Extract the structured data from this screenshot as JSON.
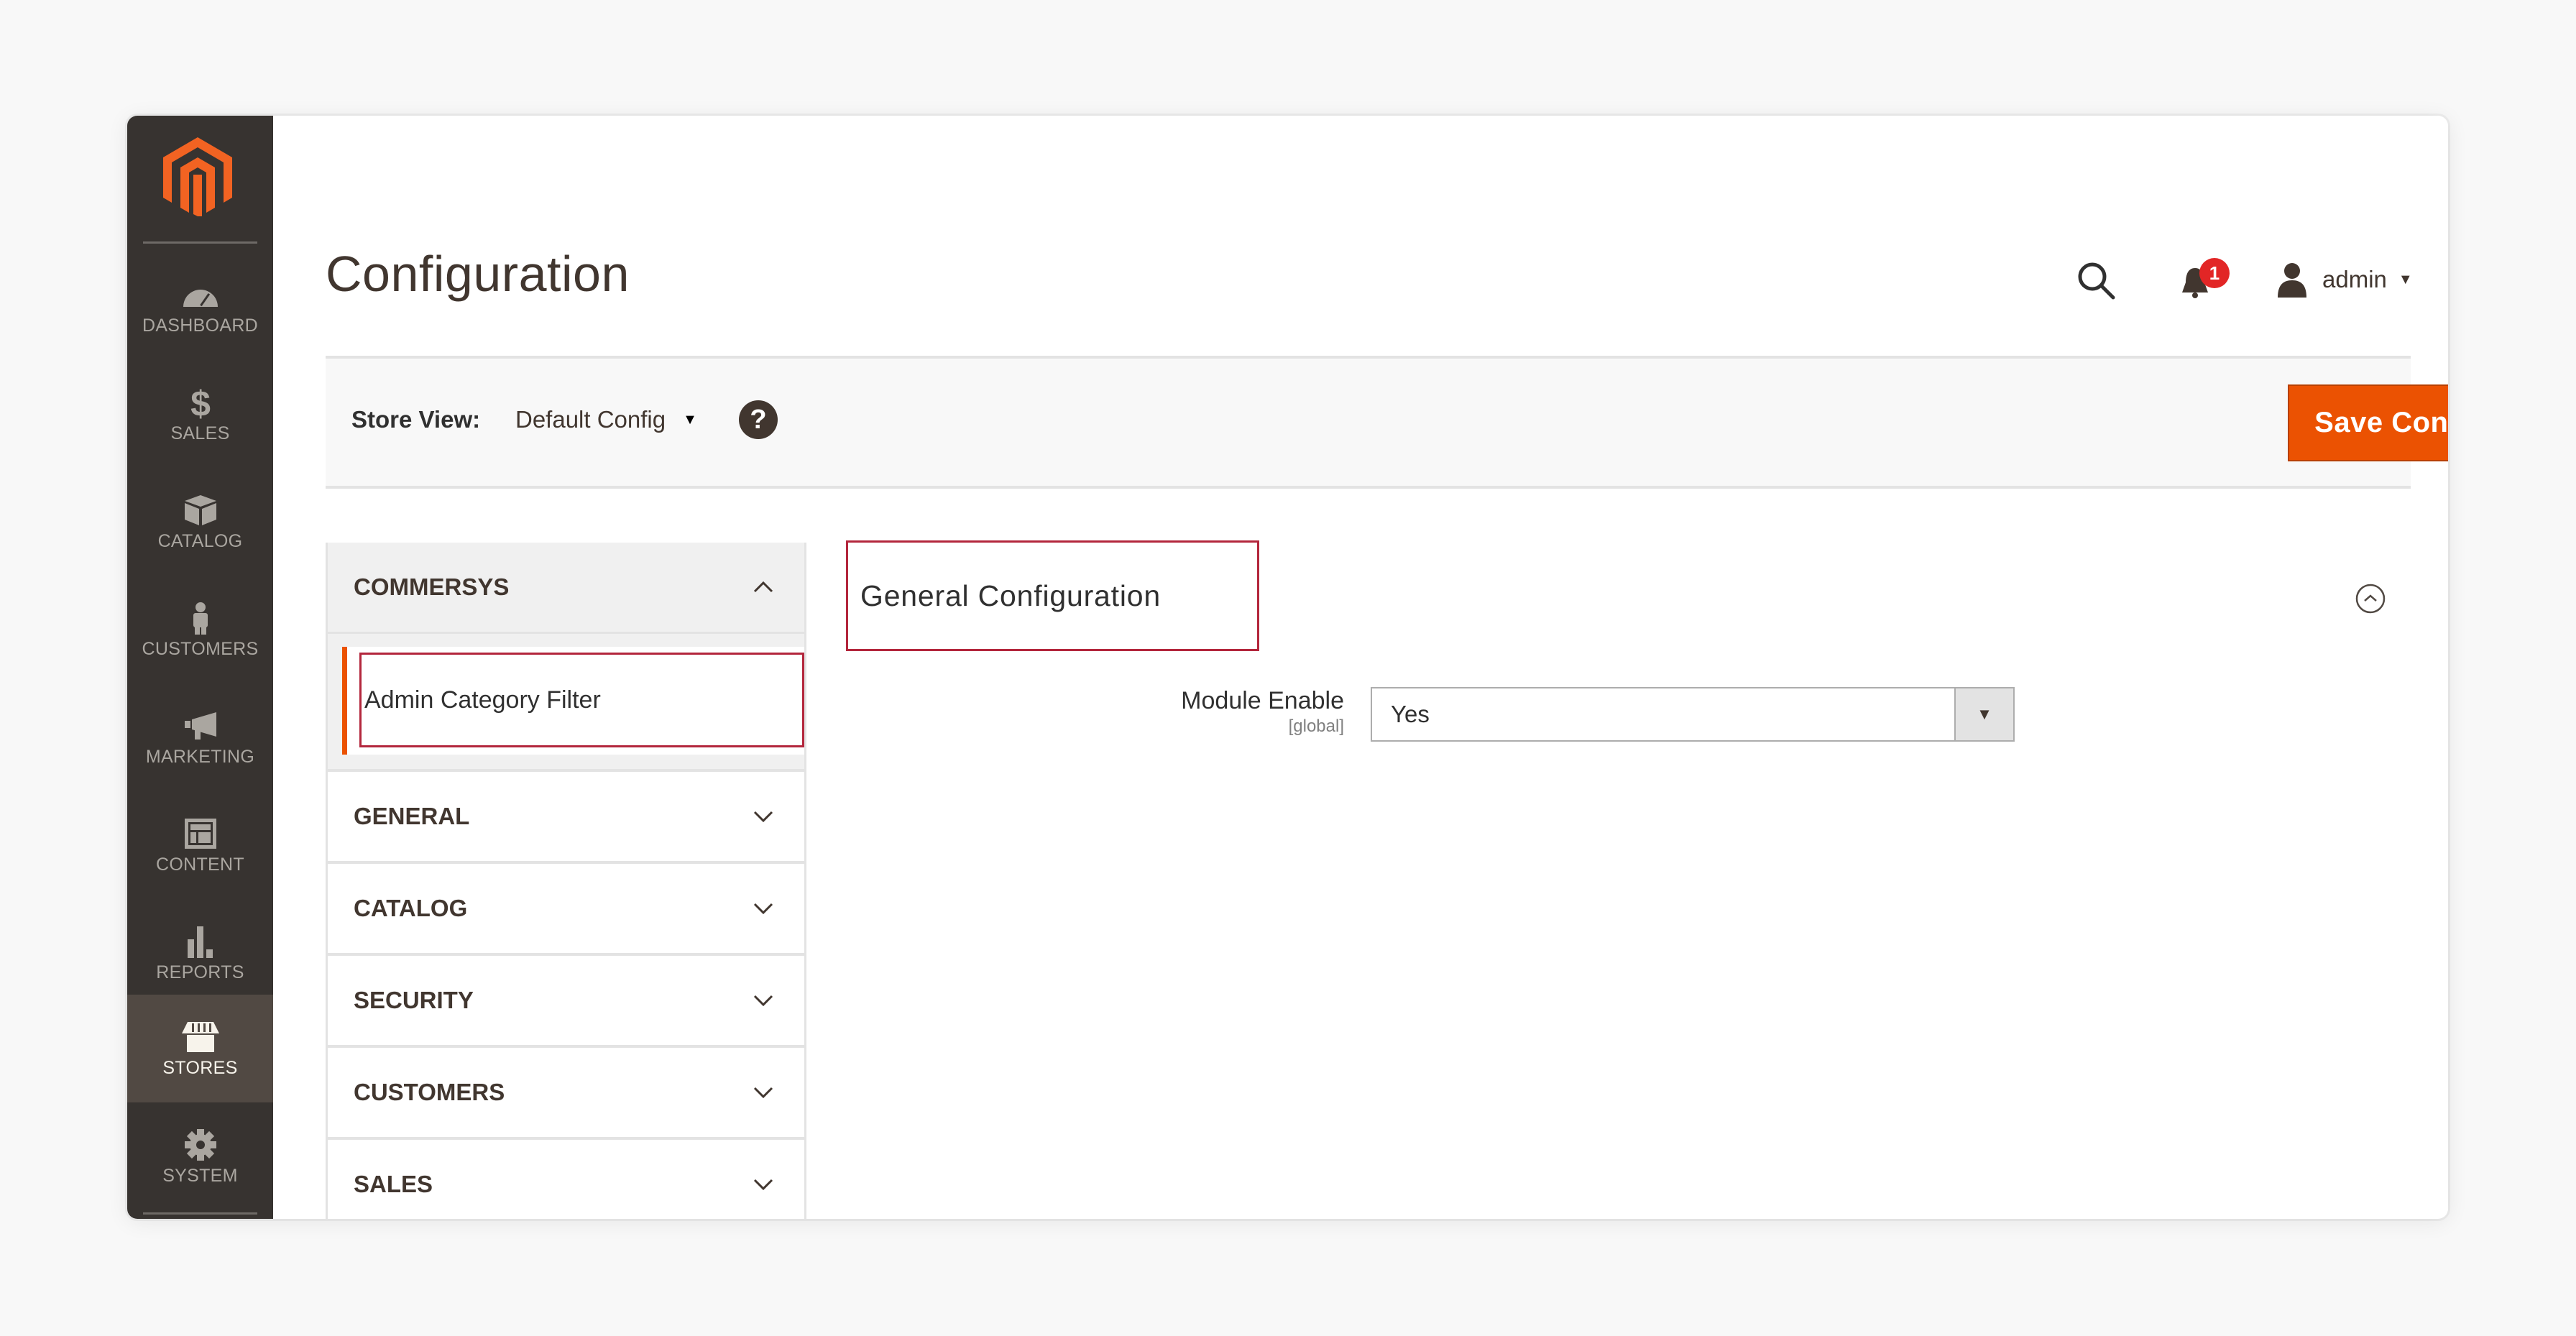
{
  "sidebar": {
    "logo": "magento-logo",
    "items": [
      {
        "label": "Dashboard",
        "icon": "dashboard-gauge-icon",
        "active": false
      },
      {
        "label": "Sales",
        "icon": "dollar-icon",
        "active": false
      },
      {
        "label": "Catalog",
        "icon": "box-icon",
        "active": false
      },
      {
        "label": "Customers",
        "icon": "person-icon",
        "active": false
      },
      {
        "label": "Marketing",
        "icon": "megaphone-icon",
        "active": false
      },
      {
        "label": "Content",
        "icon": "layout-icon",
        "active": false
      },
      {
        "label": "Reports",
        "icon": "bar-chart-icon",
        "active": false
      },
      {
        "label": "Stores",
        "icon": "storefront-icon",
        "active": true
      },
      {
        "label": "System",
        "icon": "gear-icon",
        "active": false
      }
    ]
  },
  "header": {
    "title": "Configuration",
    "notifications_count": "1",
    "user_name": "admin"
  },
  "store_bar": {
    "label": "Store View:",
    "selected_scope": "Default Config",
    "help": "?",
    "save_label": "Save Config"
  },
  "config_tabs": {
    "open_group": {
      "label": "COMMERSYS",
      "items": [
        {
          "label": "Admin Category Filter",
          "active": true
        }
      ]
    },
    "groups": [
      {
        "label": "GENERAL"
      },
      {
        "label": "CATALOG"
      },
      {
        "label": "SECURITY"
      },
      {
        "label": "CUSTOMERS"
      },
      {
        "label": "SALES"
      }
    ]
  },
  "section": {
    "title": "General Configuration",
    "fields": [
      {
        "label": "Module Enable",
        "scope": "[global]",
        "value": "Yes"
      }
    ]
  },
  "colors": {
    "accent": "#eb5202",
    "sidebar_bg": "#373330",
    "sidebar_active": "#514943",
    "highlight_outline": "#b3263c",
    "badge": "#e22626"
  }
}
